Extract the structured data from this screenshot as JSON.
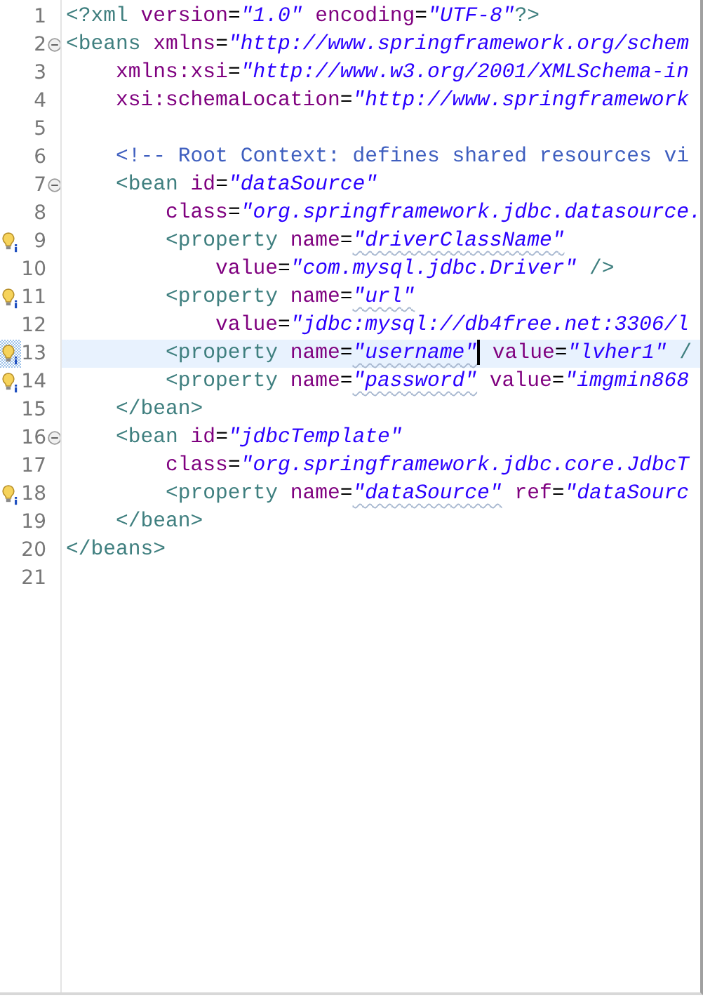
{
  "editor": {
    "lines": [
      {
        "number": "1",
        "foldable": false,
        "hint": false,
        "current": false,
        "segments": [
          {
            "kind": "tag",
            "text": "<?xml"
          },
          {
            "kind": "attr",
            "text": " version"
          },
          {
            "kind": "plain",
            "text": "="
          },
          {
            "kind": "value",
            "text": "\"1.0\"",
            "flagged": false
          },
          {
            "kind": "attr",
            "text": " encoding"
          },
          {
            "kind": "plain",
            "text": "="
          },
          {
            "kind": "value",
            "text": "\"UTF-8\"",
            "flagged": false
          },
          {
            "kind": "tag",
            "text": "?>"
          }
        ]
      },
      {
        "number": "2",
        "foldable": true,
        "hint": false,
        "current": false,
        "segments": [
          {
            "kind": "tag",
            "text": "<beans"
          },
          {
            "kind": "attr",
            "text": " xmlns"
          },
          {
            "kind": "plain",
            "text": "="
          },
          {
            "kind": "value",
            "text": "\"http://www.springframework.org/schem",
            "flagged": false
          }
        ]
      },
      {
        "number": "3",
        "foldable": false,
        "hint": false,
        "current": false,
        "segments": [
          {
            "kind": "attr",
            "text": "    xmlns:xsi"
          },
          {
            "kind": "plain",
            "text": "="
          },
          {
            "kind": "value",
            "text": "\"http://www.w3.org/2001/XMLSchema-in",
            "flagged": false
          }
        ]
      },
      {
        "number": "4",
        "foldable": false,
        "hint": false,
        "current": false,
        "segments": [
          {
            "kind": "attr",
            "text": "    xsi:schemaLocation"
          },
          {
            "kind": "plain",
            "text": "="
          },
          {
            "kind": "value",
            "text": "\"http://www.springframework",
            "flagged": false
          }
        ]
      },
      {
        "number": "5",
        "foldable": false,
        "hint": false,
        "current": false
      },
      {
        "number": "6",
        "foldable": false,
        "hint": false,
        "current": false,
        "segments": [
          {
            "kind": "comment",
            "text": "    <!-- Root Context: defines shared resources vi"
          }
        ]
      },
      {
        "number": "7",
        "foldable": true,
        "hint": false,
        "current": false,
        "segments": [
          {
            "kind": "tag",
            "text": "    <bean"
          },
          {
            "kind": "attr",
            "text": " id"
          },
          {
            "kind": "plain",
            "text": "="
          },
          {
            "kind": "value",
            "text": "\"dataSource\"",
            "flagged": false
          }
        ]
      },
      {
        "number": "8",
        "foldable": false,
        "hint": false,
        "current": false,
        "segments": [
          {
            "kind": "attr",
            "text": "        class"
          },
          {
            "kind": "plain",
            "text": "="
          },
          {
            "kind": "value",
            "text": "\"org.springframework.jdbc.datasource.",
            "flagged": false
          }
        ]
      },
      {
        "number": "9",
        "foldable": false,
        "hint": true,
        "current": false,
        "segments": [
          {
            "kind": "tag",
            "text": "        <property"
          },
          {
            "kind": "attr",
            "text": " name"
          },
          {
            "kind": "plain",
            "text": "="
          },
          {
            "kind": "value",
            "text": "\"driverClassName\"",
            "flagged": true
          }
        ]
      },
      {
        "number": "10",
        "foldable": false,
        "hint": false,
        "current": false,
        "segments": [
          {
            "kind": "attr",
            "text": "            value"
          },
          {
            "kind": "plain",
            "text": "="
          },
          {
            "kind": "value",
            "text": "\"com.mysql.jdbc.Driver\"",
            "flagged": false
          },
          {
            "kind": "tag",
            "text": " />"
          }
        ]
      },
      {
        "number": "11",
        "foldable": false,
        "hint": true,
        "current": false,
        "segments": [
          {
            "kind": "tag",
            "text": "        <property"
          },
          {
            "kind": "attr",
            "text": " name"
          },
          {
            "kind": "plain",
            "text": "="
          },
          {
            "kind": "value",
            "text": "\"url\"",
            "flagged": true
          }
        ]
      },
      {
        "number": "12",
        "foldable": false,
        "hint": false,
        "current": false,
        "segments": [
          {
            "kind": "attr",
            "text": "            value"
          },
          {
            "kind": "plain",
            "text": "="
          },
          {
            "kind": "value",
            "text": "\"jdbc:mysql://db4free.net:3306/l",
            "flagged": false
          }
        ]
      },
      {
        "number": "13",
        "foldable": false,
        "hint": true,
        "current": true,
        "segments": [
          {
            "kind": "tag",
            "text": "        <property"
          },
          {
            "kind": "attr",
            "text": " name"
          },
          {
            "kind": "plain",
            "text": "="
          },
          {
            "kind": "value",
            "text": "\"username\"",
            "flagged": true,
            "caret": true
          },
          {
            "kind": "attr",
            "text": " value"
          },
          {
            "kind": "plain",
            "text": "="
          },
          {
            "kind": "value",
            "text": "\"lvher1\"",
            "flagged": false
          },
          {
            "kind": "tag",
            "text": " /"
          }
        ]
      },
      {
        "number": "14",
        "foldable": false,
        "hint": true,
        "current": false,
        "segments": [
          {
            "kind": "tag",
            "text": "        <property"
          },
          {
            "kind": "attr",
            "text": " name"
          },
          {
            "kind": "plain",
            "text": "="
          },
          {
            "kind": "value",
            "text": "\"password\"",
            "flagged": true
          },
          {
            "kind": "attr",
            "text": " value"
          },
          {
            "kind": "plain",
            "text": "="
          },
          {
            "kind": "value",
            "text": "\"imgmin868",
            "flagged": false
          }
        ]
      },
      {
        "number": "15",
        "foldable": false,
        "hint": false,
        "current": false,
        "segments": [
          {
            "kind": "tag",
            "text": "    </bean>"
          }
        ]
      },
      {
        "number": "16",
        "foldable": true,
        "hint": false,
        "current": false,
        "segments": [
          {
            "kind": "tag",
            "text": "    <bean"
          },
          {
            "kind": "attr",
            "text": " id"
          },
          {
            "kind": "plain",
            "text": "="
          },
          {
            "kind": "value",
            "text": "\"jdbcTemplate\"",
            "flagged": false
          }
        ]
      },
      {
        "number": "17",
        "foldable": false,
        "hint": false,
        "current": false,
        "segments": [
          {
            "kind": "attr",
            "text": "        class"
          },
          {
            "kind": "plain",
            "text": "="
          },
          {
            "kind": "value",
            "text": "\"org.springframework.jdbc.core.JdbcT",
            "flagged": false
          }
        ]
      },
      {
        "number": "18",
        "foldable": false,
        "hint": true,
        "current": false,
        "segments": [
          {
            "kind": "tag",
            "text": "        <property"
          },
          {
            "kind": "attr",
            "text": " name"
          },
          {
            "kind": "plain",
            "text": "="
          },
          {
            "kind": "value",
            "text": "\"dataSource\"",
            "flagged": true
          },
          {
            "kind": "attr",
            "text": " ref"
          },
          {
            "kind": "plain",
            "text": "="
          },
          {
            "kind": "value",
            "text": "\"dataSourc",
            "flagged": false
          }
        ]
      },
      {
        "number": "19",
        "foldable": false,
        "hint": false,
        "current": false,
        "segments": [
          {
            "kind": "tag",
            "text": "    </bean>"
          }
        ]
      },
      {
        "number": "20",
        "foldable": false,
        "hint": false,
        "current": false,
        "segments": [
          {
            "kind": "tag",
            "text": "</beans>"
          }
        ]
      },
      {
        "number": "21",
        "foldable": false,
        "hint": false,
        "current": false
      }
    ]
  }
}
